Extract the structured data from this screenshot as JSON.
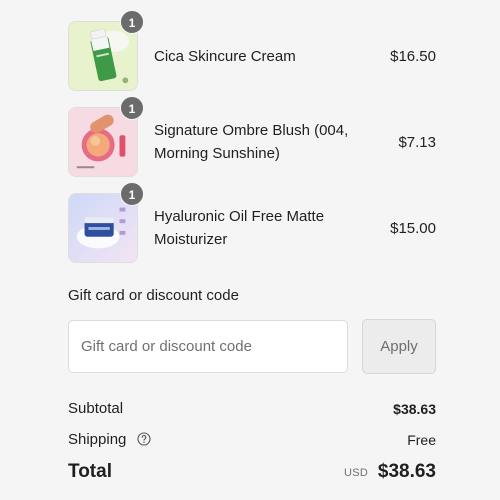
{
  "items": [
    {
      "quantity": "1",
      "name": "Cica Skincure Cream",
      "price": "$16.50",
      "image": "green-cream-tube-thumbnail"
    },
    {
      "quantity": "1",
      "name": "Signature Ombre Blush (004, Morning Sunshine)",
      "price": "$7.13",
      "image": "pink-blush-compact-thumbnail"
    },
    {
      "quantity": "1",
      "name": "Hyaluronic Oil Free Matte Moisturizer",
      "price": "$15.00",
      "image": "blue-moisturizer-jar-thumbnail"
    }
  ],
  "discount": {
    "title": "Gift card or discount code",
    "placeholder": "Gift card or discount code",
    "value": "",
    "apply_label": "Apply"
  },
  "summary": {
    "subtotal_label": "Subtotal",
    "subtotal_value": "$38.63",
    "shipping_label": "Shipping",
    "shipping_icon": "question-circle-icon",
    "shipping_value": "Free",
    "total_label": "Total",
    "currency": "USD",
    "total_value": "$38.63"
  },
  "colors": {
    "background": "#f5f5f5",
    "badge": "#6b6b6b",
    "text": "#1f1f1f",
    "muted": "#707070"
  }
}
